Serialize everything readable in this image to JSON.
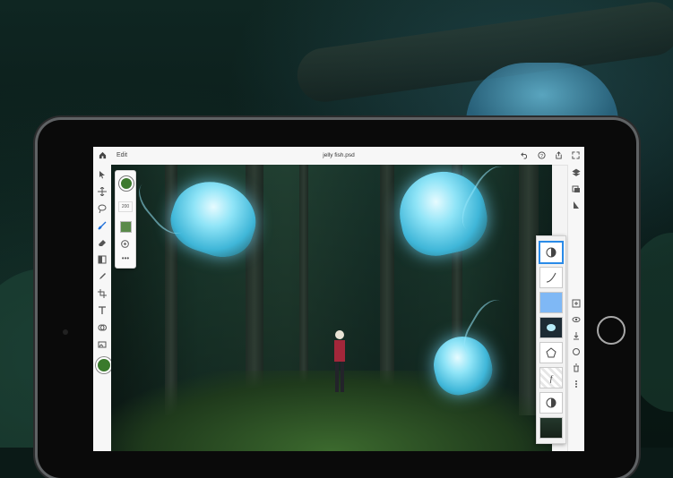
{
  "app": {
    "edit_label": "Edit",
    "document_title": "jelly fish.psd"
  },
  "tool_options": {
    "brush_size": "200",
    "more_label": "•••"
  },
  "colors": {
    "foreground": "#3a7a2c",
    "accent": "#2a8be8",
    "layer_fill": "#7fb8f5"
  },
  "icons": {
    "left_toolbar": [
      "select-icon",
      "move-icon",
      "lasso-icon",
      "brush-icon",
      "eraser-icon",
      "gradient-icon",
      "eyedropper-icon",
      "crop-icon",
      "text-icon",
      "clone-icon",
      "image-icon"
    ],
    "top_right": [
      "undo-icon",
      "help-icon",
      "share-icon",
      "fullscreen-icon"
    ],
    "right_toolbar": [
      "layers-icon",
      "layer-properties-icon",
      "add-layer-icon",
      "visibility-icon",
      "merge-icon",
      "mask-icon",
      "delete-icon",
      "more-icon"
    ]
  },
  "layers": [
    {
      "name": "adjustment-layer",
      "icon": "adjust-icon"
    },
    {
      "name": "curve-layer",
      "icon": "curve-icon"
    },
    {
      "name": "color-fill-layer",
      "icon": "fill-icon"
    },
    {
      "name": "image-layer",
      "icon": "image-icon"
    },
    {
      "name": "shape-layer",
      "icon": "shape-icon"
    },
    {
      "name": "text-layer",
      "icon": "text-icon",
      "label": "f"
    },
    {
      "name": "adjustment-layer-2",
      "icon": "adjust-icon"
    },
    {
      "name": "background-photo-layer",
      "icon": "photo-icon"
    }
  ]
}
